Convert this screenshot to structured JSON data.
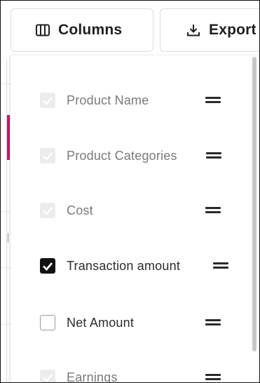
{
  "toolbar": {
    "columns_label": "Columns",
    "columns_icon": "columns-icon",
    "export_label": "Export",
    "export_icon": "download-icon"
  },
  "column_menu": {
    "items": [
      {
        "label": "Product Name",
        "state": "checked-disabled"
      },
      {
        "label": "Product Categories",
        "state": "checked-disabled"
      },
      {
        "label": "Cost",
        "state": "checked-disabled"
      },
      {
        "label": "Transaction amount",
        "state": "checked"
      },
      {
        "label": "Net Amount",
        "state": "unchecked"
      },
      {
        "label": "Earnings",
        "state": "checked-disabled"
      }
    ],
    "handle_icon": "drag-handle-icon"
  },
  "colors": {
    "accent": "#e6006e",
    "checked_fill": "#111111",
    "disabled_fill": "#ececec",
    "muted_text": "#7a7a7a"
  }
}
